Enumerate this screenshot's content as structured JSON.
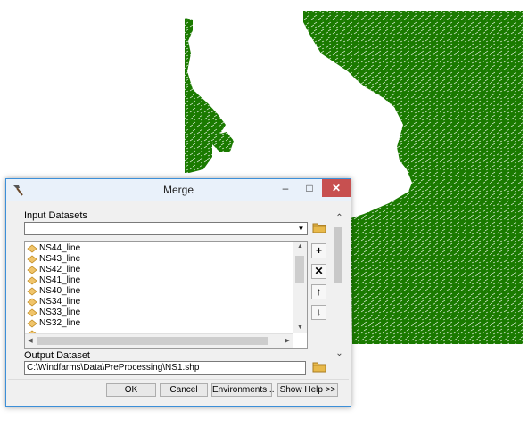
{
  "window": {
    "title": "Merge"
  },
  "input_datasets": {
    "label": "Input Datasets",
    "items": [
      {
        "name": "NS44_line"
      },
      {
        "name": "NS43_line"
      },
      {
        "name": "NS42_line"
      },
      {
        "name": "NS41_line"
      },
      {
        "name": "NS40_line"
      },
      {
        "name": "NS34_line"
      },
      {
        "name": "NS33_line"
      },
      {
        "name": "NS32_line"
      }
    ]
  },
  "output_dataset": {
    "label": "Output Dataset",
    "value": "C:\\Windfarms\\Data\\PreProcessing\\NS1.shp"
  },
  "buttons": {
    "ok": "OK",
    "cancel": "Cancel",
    "environments": "Environments...",
    "show_help": "Show Help >>"
  },
  "colors": {
    "map_features": "#1a7a00",
    "title_bar": "#e9f1fa",
    "close_button": "#c75050",
    "window_border": "#3c8fd8"
  }
}
